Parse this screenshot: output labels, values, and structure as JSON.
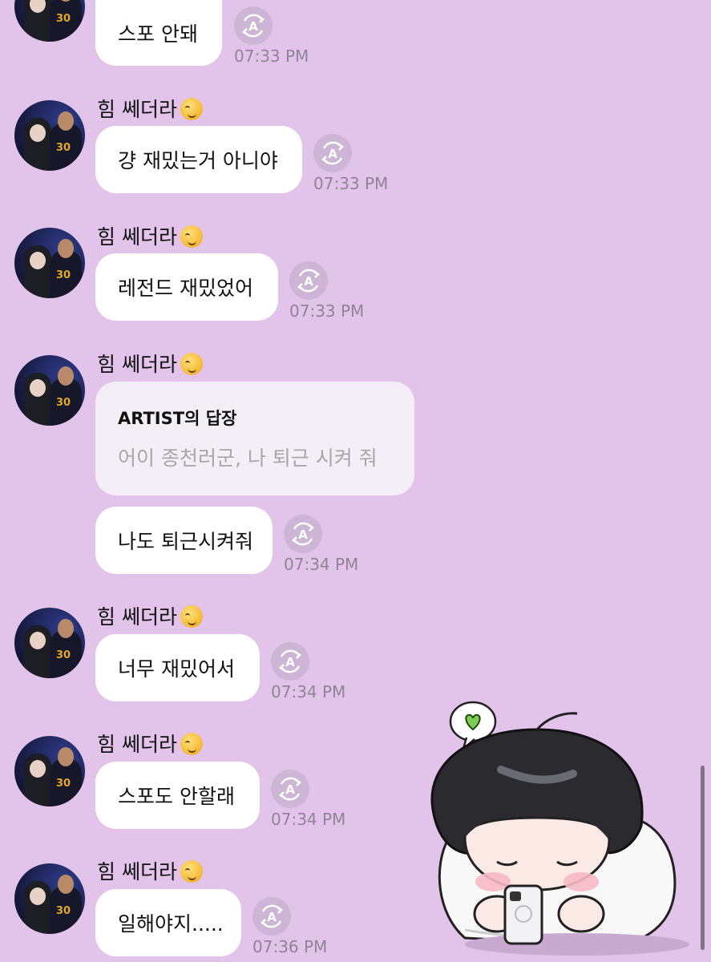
{
  "messages": [
    {
      "sender": "",
      "text": "스포 안돼",
      "time": "07:33 PM"
    },
    {
      "sender": "힘 쎄더라",
      "text": "걍 재밌는거 아니야",
      "time": "07:33 PM"
    },
    {
      "sender": "힘 쎄더라",
      "text": "레전드 재밌었어",
      "time": "07:33 PM"
    },
    {
      "sender": "힘 쎄더라",
      "reply_title": "ARTIST의 답장",
      "reply_text": "어이 종천러군, 나 퇴근 시켜 줘",
      "text": "나도 퇴근시켜줘",
      "time": "07:34 PM"
    },
    {
      "sender": "힘 쎄더라",
      "text": "너무 재밌어서",
      "time": "07:34 PM"
    },
    {
      "sender": "힘 쎄더라",
      "text": "스포도 안할래",
      "time": "07:34 PM"
    },
    {
      "sender": "힘 쎄더라",
      "text": "일해야지.....",
      "time": "07:36 PM"
    }
  ],
  "icons": {
    "avatar": "profile-photo",
    "translate": "translate-icon",
    "emoji": "smirking-face-emoji",
    "sticker": "chibi-sticker-with-heart"
  },
  "colors": {
    "background": "#e2c4ea",
    "bubble": "#ffffff",
    "reply_card": "#f4eff6",
    "time": "#8f8494",
    "translate_button": "#cdb5d5"
  }
}
